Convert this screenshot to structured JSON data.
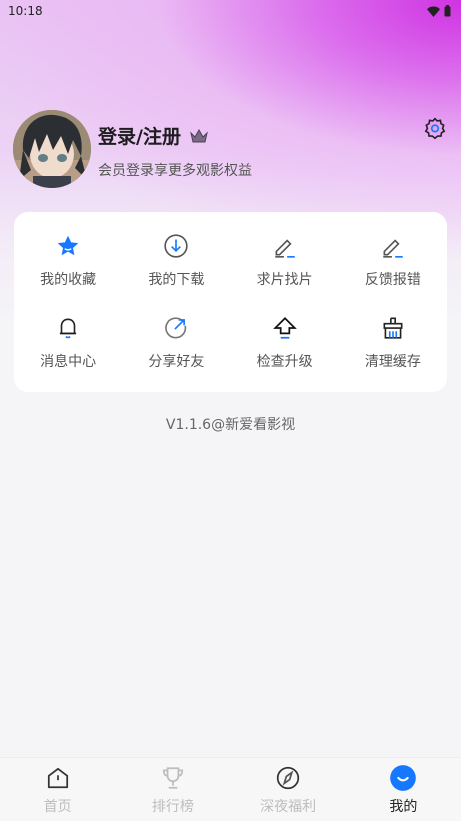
{
  "status": {
    "time": "10:18"
  },
  "profile": {
    "name": "登录/注册",
    "subtitle": "会员登录享更多观影权益"
  },
  "menu": [
    {
      "label": "我的收藏",
      "icon": "star-icon",
      "color": "#1677ff"
    },
    {
      "label": "我的下载",
      "icon": "download-icon",
      "color": "#1677ff"
    },
    {
      "label": "求片找片",
      "icon": "edit-icon",
      "color": "#1677ff"
    },
    {
      "label": "反馈报错",
      "icon": "feedback-edit-icon",
      "color": "#1677ff"
    },
    {
      "label": "消息中心",
      "icon": "bell-icon",
      "color": "#1677ff"
    },
    {
      "label": "分享好友",
      "icon": "share-icon",
      "color": "#1677ff"
    },
    {
      "label": "检查升级",
      "icon": "upgrade-icon",
      "color": "#1677ff"
    },
    {
      "label": "清理缓存",
      "icon": "clean-cache-icon",
      "color": "#1677ff"
    }
  ],
  "version": "V1.1.6@新爱看影视",
  "tabs": [
    {
      "label": "首页",
      "icon": "home-icon",
      "active": false
    },
    {
      "label": "排行榜",
      "icon": "trophy-icon",
      "active": false
    },
    {
      "label": "深夜福利",
      "icon": "compass-icon",
      "active": false
    },
    {
      "label": "我的",
      "icon": "profile-smile-icon",
      "active": true
    }
  ],
  "colors": {
    "accent": "#1677ff",
    "gradient": "#d02ae0"
  }
}
